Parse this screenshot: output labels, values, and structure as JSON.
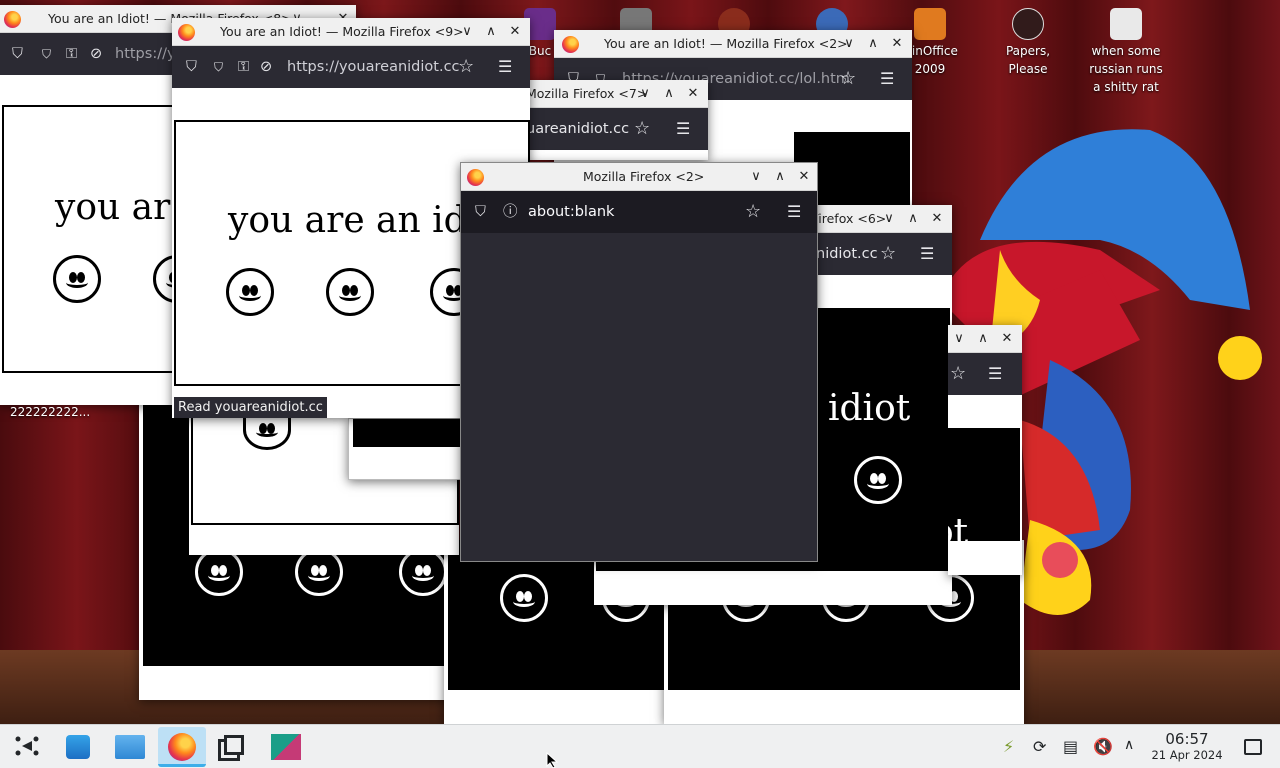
{
  "desktop_icons": [
    {
      "label": "Buc",
      "color": "#6a2d8a"
    },
    {
      "label": "",
      "color": "#777777"
    },
    {
      "label": "",
      "color": "#8a2c1c"
    },
    {
      "label": "",
      "color": "#3b6ab8"
    },
    {
      "label": "winOffice\n2009",
      "color": "#e07a1f"
    },
    {
      "label": "Papers,\nPlease",
      "color": "#311b1b"
    },
    {
      "label": "when some\nrussian runs\na shitty rat",
      "color": "#e9e9e9"
    }
  ],
  "windows": {
    "w8": {
      "title": "You are an Idiot! — Mozilla Firefox <8>",
      "url": "https://y",
      "heading": "you are",
      "status": "222222222..."
    },
    "w9": {
      "title": "You are an Idiot! — Mozilla Firefox <9>",
      "url": "https://youareanidiot.cc",
      "heading": "you are an idio",
      "status": "Read youareanidiot.cc"
    },
    "w2a": {
      "title": "You are an Idiot! — Mozilla Firefox <2>",
      "url": "https://youareanidiot.cc/lol.htm"
    },
    "w7": {
      "title": "Mozilla Firefox <7>",
      "url": "uareanidiot.cc"
    },
    "w6": {
      "title": "Firefox <6>",
      "url": "nidiot.cc",
      "heading": "idiot",
      "heading2": "ot"
    },
    "w2b": {
      "title": "Mozilla Firefox <2>",
      "url": "about:blank"
    }
  },
  "clock": {
    "time": "06:57",
    "date": "21 Apr 2024"
  },
  "icons": {
    "menu": "☰",
    "star": "☆",
    "min": "∨",
    "max": "∧",
    "close": "✕",
    "shield": "⛉",
    "lock": "🔒",
    "info": "ⓘ"
  }
}
